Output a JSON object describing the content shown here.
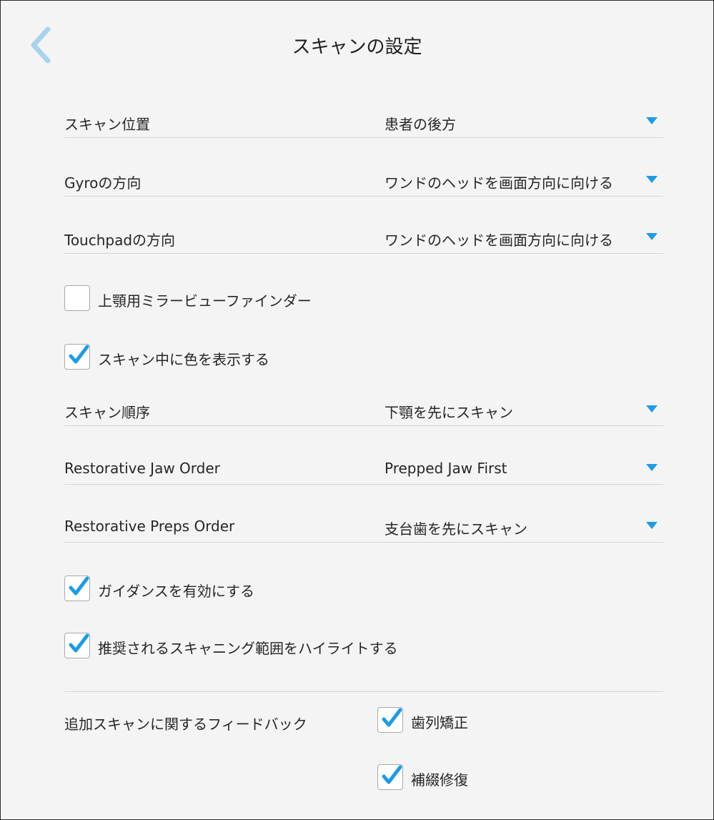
{
  "header": {
    "title": "スキャンの設定",
    "back_icon": "chevron-left-icon",
    "accent_color": "#1d9be6"
  },
  "settings": {
    "scan_position": {
      "label": "スキャン位置",
      "value": "患者の後方"
    },
    "gyro_direction": {
      "label": "Gyroの方向",
      "value": "ワンドのヘッドを画面方向に向ける"
    },
    "touchpad_direction": {
      "label": "Touchpadの方向",
      "value": "ワンドのヘッドを画面方向に向ける"
    },
    "scan_order": {
      "label": "スキャン順序",
      "value": "下顎を先にスキャン"
    },
    "restorative_jaw_order": {
      "label": "Restorative Jaw Order",
      "value": "Prepped Jaw First"
    },
    "restorative_preps_order": {
      "label": "Restorative Preps Order",
      "value": "支台歯を先にスキャン"
    }
  },
  "checkboxes": {
    "mirror_viewfinder": {
      "label": "上顎用ミラービューファインダー",
      "checked": false
    },
    "show_color": {
      "label": "スキャン中に色を表示する",
      "checked": true
    },
    "enable_guidance": {
      "label": "ガイダンスを有効にする",
      "checked": true
    },
    "highlight_range": {
      "label": "推奨されるスキャニング範囲をハイライトする",
      "checked": true
    }
  },
  "feedback": {
    "label": "追加スキャンに関するフィードバック",
    "orthodontic": {
      "label": "歯列矯正",
      "checked": true
    },
    "restorative": {
      "label": "補綴修復",
      "checked": true
    }
  }
}
